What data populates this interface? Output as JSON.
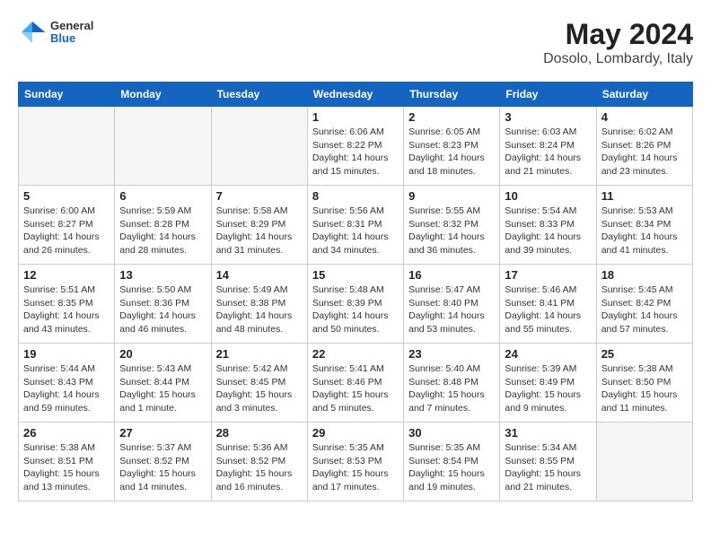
{
  "header": {
    "logo": {
      "general": "General",
      "blue": "Blue"
    },
    "title": "May 2024",
    "location": "Dosolo, Lombardy, Italy"
  },
  "days_of_week": [
    "Sunday",
    "Monday",
    "Tuesday",
    "Wednesday",
    "Thursday",
    "Friday",
    "Saturday"
  ],
  "weeks": [
    [
      {
        "day": "",
        "info": ""
      },
      {
        "day": "",
        "info": ""
      },
      {
        "day": "",
        "info": ""
      },
      {
        "day": "1",
        "info": "Sunrise: 6:06 AM\nSunset: 8:22 PM\nDaylight: 14 hours\nand 15 minutes."
      },
      {
        "day": "2",
        "info": "Sunrise: 6:05 AM\nSunset: 8:23 PM\nDaylight: 14 hours\nand 18 minutes."
      },
      {
        "day": "3",
        "info": "Sunrise: 6:03 AM\nSunset: 8:24 PM\nDaylight: 14 hours\nand 21 minutes."
      },
      {
        "day": "4",
        "info": "Sunrise: 6:02 AM\nSunset: 8:26 PM\nDaylight: 14 hours\nand 23 minutes."
      }
    ],
    [
      {
        "day": "5",
        "info": "Sunrise: 6:00 AM\nSunset: 8:27 PM\nDaylight: 14 hours\nand 26 minutes."
      },
      {
        "day": "6",
        "info": "Sunrise: 5:59 AM\nSunset: 8:28 PM\nDaylight: 14 hours\nand 28 minutes."
      },
      {
        "day": "7",
        "info": "Sunrise: 5:58 AM\nSunset: 8:29 PM\nDaylight: 14 hours\nand 31 minutes."
      },
      {
        "day": "8",
        "info": "Sunrise: 5:56 AM\nSunset: 8:31 PM\nDaylight: 14 hours\nand 34 minutes."
      },
      {
        "day": "9",
        "info": "Sunrise: 5:55 AM\nSunset: 8:32 PM\nDaylight: 14 hours\nand 36 minutes."
      },
      {
        "day": "10",
        "info": "Sunrise: 5:54 AM\nSunset: 8:33 PM\nDaylight: 14 hours\nand 39 minutes."
      },
      {
        "day": "11",
        "info": "Sunrise: 5:53 AM\nSunset: 8:34 PM\nDaylight: 14 hours\nand 41 minutes."
      }
    ],
    [
      {
        "day": "12",
        "info": "Sunrise: 5:51 AM\nSunset: 8:35 PM\nDaylight: 14 hours\nand 43 minutes."
      },
      {
        "day": "13",
        "info": "Sunrise: 5:50 AM\nSunset: 8:36 PM\nDaylight: 14 hours\nand 46 minutes."
      },
      {
        "day": "14",
        "info": "Sunrise: 5:49 AM\nSunset: 8:38 PM\nDaylight: 14 hours\nand 48 minutes."
      },
      {
        "day": "15",
        "info": "Sunrise: 5:48 AM\nSunset: 8:39 PM\nDaylight: 14 hours\nand 50 minutes."
      },
      {
        "day": "16",
        "info": "Sunrise: 5:47 AM\nSunset: 8:40 PM\nDaylight: 14 hours\nand 53 minutes."
      },
      {
        "day": "17",
        "info": "Sunrise: 5:46 AM\nSunset: 8:41 PM\nDaylight: 14 hours\nand 55 minutes."
      },
      {
        "day": "18",
        "info": "Sunrise: 5:45 AM\nSunset: 8:42 PM\nDaylight: 14 hours\nand 57 minutes."
      }
    ],
    [
      {
        "day": "19",
        "info": "Sunrise: 5:44 AM\nSunset: 8:43 PM\nDaylight: 14 hours\nand 59 minutes."
      },
      {
        "day": "20",
        "info": "Sunrise: 5:43 AM\nSunset: 8:44 PM\nDaylight: 15 hours\nand 1 minute."
      },
      {
        "day": "21",
        "info": "Sunrise: 5:42 AM\nSunset: 8:45 PM\nDaylight: 15 hours\nand 3 minutes."
      },
      {
        "day": "22",
        "info": "Sunrise: 5:41 AM\nSunset: 8:46 PM\nDaylight: 15 hours\nand 5 minutes."
      },
      {
        "day": "23",
        "info": "Sunrise: 5:40 AM\nSunset: 8:48 PM\nDaylight: 15 hours\nand 7 minutes."
      },
      {
        "day": "24",
        "info": "Sunrise: 5:39 AM\nSunset: 8:49 PM\nDaylight: 15 hours\nand 9 minutes."
      },
      {
        "day": "25",
        "info": "Sunrise: 5:38 AM\nSunset: 8:50 PM\nDaylight: 15 hours\nand 11 minutes."
      }
    ],
    [
      {
        "day": "26",
        "info": "Sunrise: 5:38 AM\nSunset: 8:51 PM\nDaylight: 15 hours\nand 13 minutes."
      },
      {
        "day": "27",
        "info": "Sunrise: 5:37 AM\nSunset: 8:52 PM\nDaylight: 15 hours\nand 14 minutes."
      },
      {
        "day": "28",
        "info": "Sunrise: 5:36 AM\nSunset: 8:52 PM\nDaylight: 15 hours\nand 16 minutes."
      },
      {
        "day": "29",
        "info": "Sunrise: 5:35 AM\nSunset: 8:53 PM\nDaylight: 15 hours\nand 17 minutes."
      },
      {
        "day": "30",
        "info": "Sunrise: 5:35 AM\nSunset: 8:54 PM\nDaylight: 15 hours\nand 19 minutes."
      },
      {
        "day": "31",
        "info": "Sunrise: 5:34 AM\nSunset: 8:55 PM\nDaylight: 15 hours\nand 21 minutes."
      },
      {
        "day": "",
        "info": ""
      }
    ]
  ]
}
